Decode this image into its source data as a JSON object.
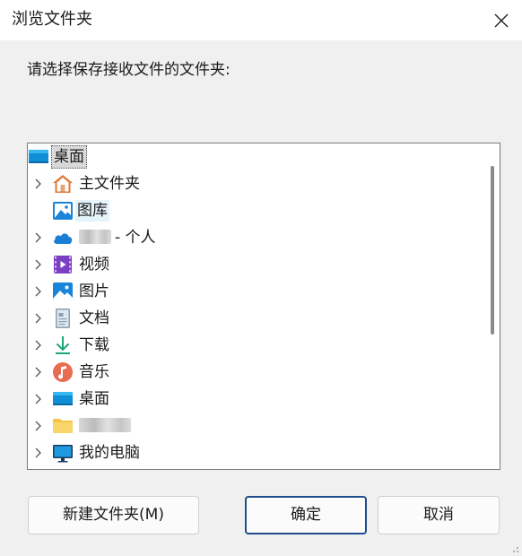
{
  "window": {
    "title": "浏览文件夹",
    "close_icon": "close-icon"
  },
  "prompt": "请选择保存接收文件的文件夹:",
  "tree": {
    "root": {
      "label": "桌面",
      "icon": "desktop-icon"
    },
    "items": [
      {
        "label": "主文件夹",
        "icon": "home-icon",
        "expandable": true
      },
      {
        "label": "图库",
        "icon": "gallery-icon",
        "expandable": false
      },
      {
        "label": "- 个人",
        "icon": "onedrive-cloud-icon",
        "expandable": true,
        "redacted_prefix": true
      },
      {
        "label": "视频",
        "icon": "videos-icon",
        "expandable": true
      },
      {
        "label": "图片",
        "icon": "pictures-icon",
        "expandable": true
      },
      {
        "label": "文档",
        "icon": "documents-icon",
        "expandable": true
      },
      {
        "label": "下载",
        "icon": "downloads-icon",
        "expandable": true
      },
      {
        "label": "音乐",
        "icon": "music-icon",
        "expandable": true
      },
      {
        "label": "桌面",
        "icon": "desktop-icon",
        "expandable": true
      },
      {
        "label": "",
        "icon": "folder-icon",
        "expandable": true,
        "redacted_prefix": true
      },
      {
        "label": "我的电脑",
        "icon": "computer-icon",
        "expandable": true
      }
    ]
  },
  "buttons": {
    "new_folder": "新建文件夹(M)",
    "ok": "确定",
    "cancel": "取消"
  },
  "colors": {
    "dialog_bg": "#f0f0f0",
    "titlebar_bg": "#ffffff",
    "ok_border": "#1f4e8c"
  }
}
